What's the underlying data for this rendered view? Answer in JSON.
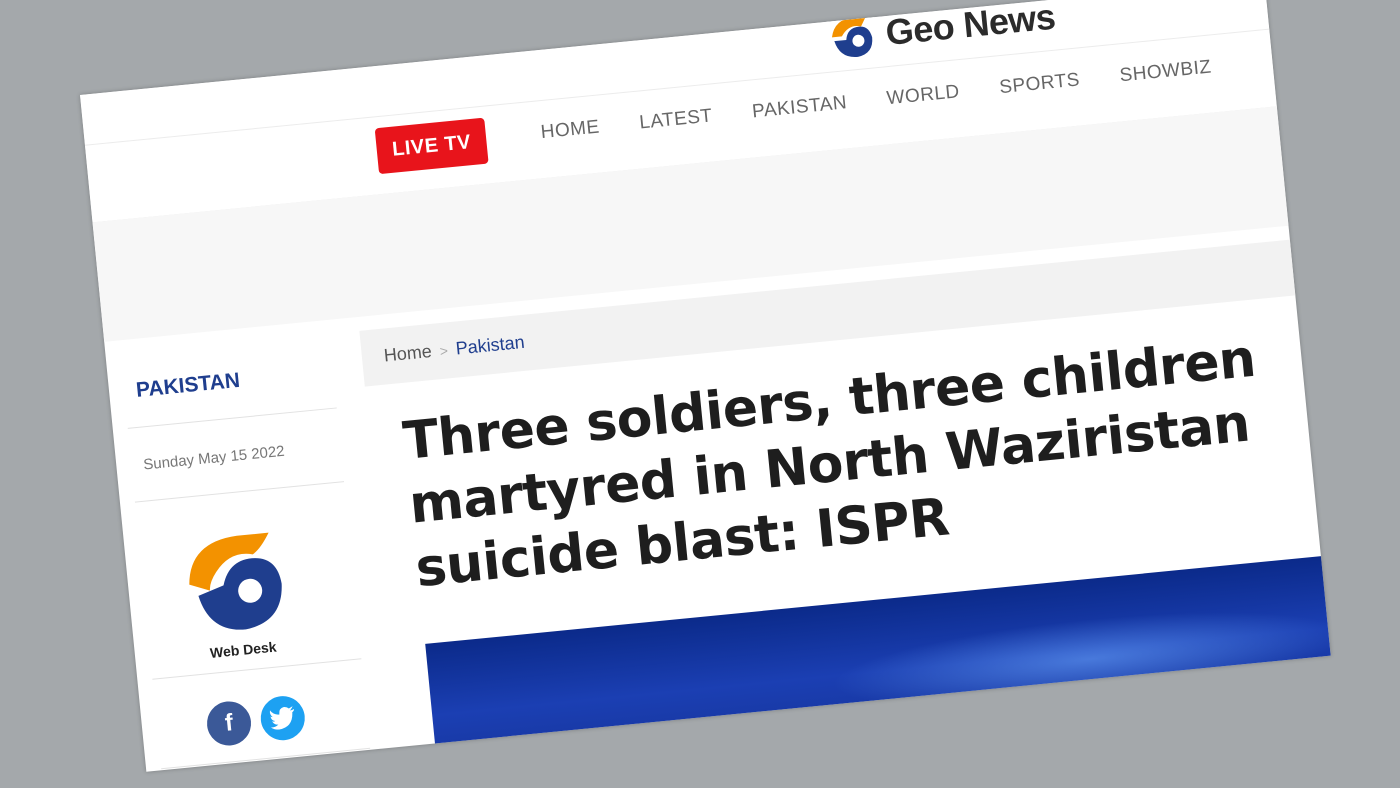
{
  "header": {
    "logo_text": "Geo News",
    "live_label": "LIVE TV",
    "nav": [
      "HOME",
      "LATEST",
      "PAKISTAN",
      "WORLD",
      "SPORTS",
      "SHOWBIZ"
    ]
  },
  "sidebar": {
    "category": "PAKISTAN",
    "date": "Sunday May 15 2022",
    "author": "Web Desk",
    "social": {
      "facebook_icon": "facebook-icon",
      "twitter_icon": "twitter-icon"
    }
  },
  "breadcrumb": {
    "home": "Home",
    "separator": ">",
    "category": "Pakistan"
  },
  "article": {
    "headline": "Three soldiers, three children martyred in North Waziristan suicide blast: ISPR"
  },
  "colors": {
    "brand_blue": "#1f3e8e",
    "brand_orange": "#f39200",
    "live_red": "#e8141b"
  }
}
